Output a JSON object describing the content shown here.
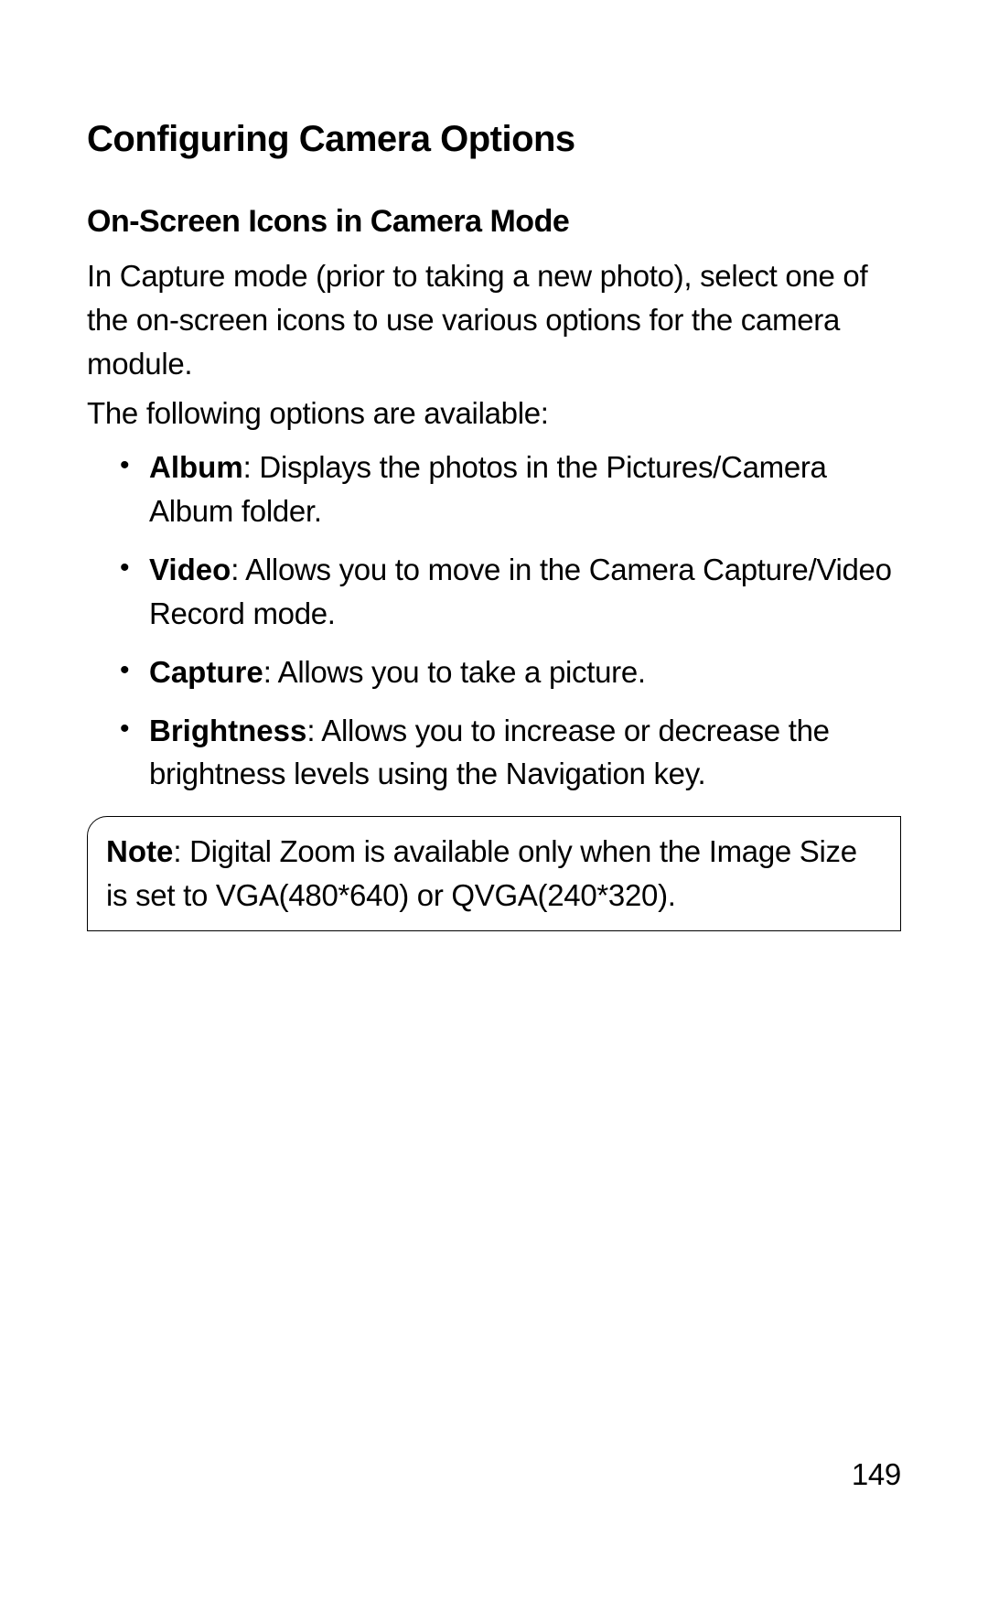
{
  "section_title": "Configuring Camera Options",
  "subsection_title": "On-Screen Icons in Camera Mode",
  "intro_paragraph": "In Capture mode (prior to taking a new photo), select one of the on-screen icons to use various options for the camera module.",
  "options_intro": "The following options are available:",
  "options": [
    {
      "label": "Album",
      "description": ": Displays the photos in the Pictures/Camera Album folder."
    },
    {
      "label": "Video",
      "description": ": Allows you to move in the Camera Capture/Video Record mode."
    },
    {
      "label": "Capture",
      "description": ": Allows you to take a picture."
    },
    {
      "label": "Brightness",
      "description": ": Allows you to increase or decrease the brightness levels using the Navigation key."
    }
  ],
  "note": {
    "label": "Note",
    "text": ": Digital Zoom is available only when the Image Size is set to VGA(480*640) or QVGA(240*320)."
  },
  "page_number": "149"
}
